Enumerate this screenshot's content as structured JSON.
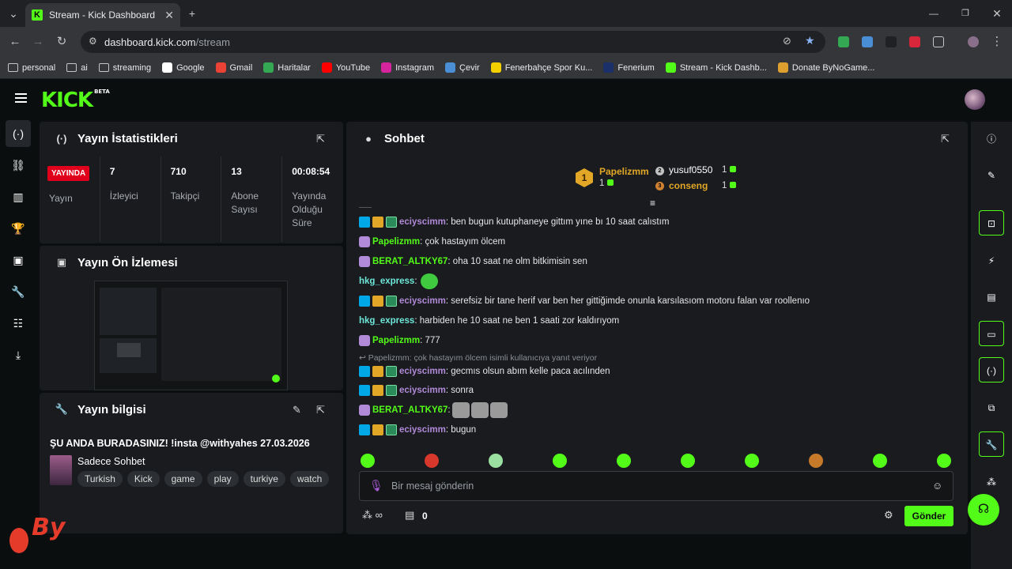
{
  "browser": {
    "tab_title": "Stream - Kick Dashboard",
    "url_host": "dashboard.kick.com",
    "url_path": "/stream",
    "bookmarks": [
      {
        "label": "personal",
        "icon": "folder-icon"
      },
      {
        "label": "ai",
        "icon": "folder-icon"
      },
      {
        "label": "streaming",
        "icon": "folder-icon"
      },
      {
        "label": "Google",
        "icon": "google-icon"
      },
      {
        "label": "Gmail",
        "icon": "gmail-icon"
      },
      {
        "label": "Haritalar",
        "icon": "maps-icon"
      },
      {
        "label": "YouTube",
        "icon": "youtube-icon"
      },
      {
        "label": "Instagram",
        "icon": "instagram-icon"
      },
      {
        "label": "Çevir",
        "icon": "translate-icon"
      },
      {
        "label": "Fenerbahçe Spor Ku...",
        "icon": "fenerbahce-icon"
      },
      {
        "label": "Fenerium",
        "icon": "fenerium-icon"
      },
      {
        "label": "Stream - Kick Dashb...",
        "icon": "kick-icon"
      },
      {
        "label": "Donate ByNoGame...",
        "icon": "bynogame-icon"
      }
    ]
  },
  "app": {
    "logo": "KICK",
    "logo_badge": "BETA"
  },
  "stats": {
    "title": "Yayın İstatistikleri",
    "live_badge": "YAYINDA",
    "live_label": "Yayın",
    "cols": [
      {
        "value": "7",
        "label": "İzleyici"
      },
      {
        "value": "710",
        "label": "Takipçi"
      },
      {
        "value": "13",
        "label": "Abone Sayısı"
      },
      {
        "value": "00:08:54",
        "label": "Yayında Olduğu Süre"
      }
    ]
  },
  "preview": {
    "title": "Yayın Ön İzlemesi"
  },
  "info": {
    "title": "Yayın bilgisi",
    "stream_title": "ŞU ANDA BURADASINIZ! !insta @withyahes 27.03.2026",
    "category": "Sadece Sohbet",
    "tags": [
      "Turkish",
      "Kick",
      "game",
      "play",
      "turkiye",
      "watch"
    ]
  },
  "chat": {
    "title": "Sohbet",
    "top_gifters": [
      {
        "rank": "1",
        "name": "Papelizmm",
        "count": "1"
      },
      {
        "rank": "2",
        "name": "yusuf0550",
        "count": "1"
      },
      {
        "rank": "3",
        "name": "conseng",
        "count": "1"
      }
    ],
    "messages": [
      {
        "user": "eciyscimm",
        "text": ": ben bugun kutuphaneye gittım yıne bı 10 saat calıstım"
      },
      {
        "user": "Papelizmm",
        "text": ": çok hastayım ölcem"
      },
      {
        "user": "BERAT_ALTKY67",
        "text": ": oha 10 saat ne olm bitkimisin sen"
      },
      {
        "user": "hkg_express",
        "text": ":"
      },
      {
        "user": "eciyscimm",
        "text": ": serefsiz bir tane herif var ben her gittiğimde onunla karsılasıom motoru falan var roollenıo"
      },
      {
        "user": "hkg_express",
        "text": ": harbiden he 10 saat ne ben 1 saati zor kaldırıyom"
      },
      {
        "user": "Papelizmm",
        "text": ": 777"
      },
      {
        "user": "eciyscimm",
        "text": ": gecmıs olsun abım kelle paca acılınden"
      },
      {
        "user": "eciyscimm",
        "text": ": sonra"
      },
      {
        "user": "BERAT_ALTKY67",
        "text": ":"
      },
      {
        "user": "eciyscimm",
        "text": ": bugun"
      }
    ],
    "reply_context": "Papelizmm: çok hastayım ölcem isimli kullanıcıya yanıt veriyor",
    "input_placeholder": "Bir mesaj gönderin",
    "kicks_count": "0",
    "send_label": "Gönder"
  },
  "colors": {
    "accent": "#53fc18",
    "live": "#e0001b",
    "user_purple": "#b18ad8",
    "user_green": "#53fc18",
    "user_blue": "#6ee7d8",
    "gold": "#e2a726"
  }
}
